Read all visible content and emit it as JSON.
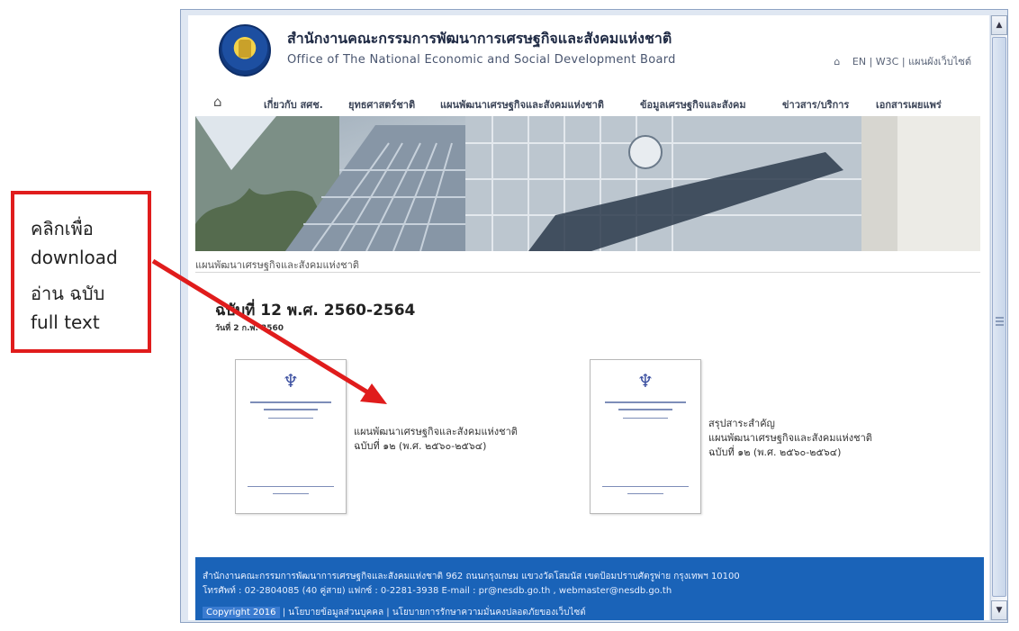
{
  "annotation": {
    "lines": [
      "คลิกเพื่อ",
      "download",
      "อ่าน ฉบับ",
      "full text"
    ],
    "color": "#e01c1c"
  },
  "header": {
    "org_name_th": "สำนักงานคณะกรรมการพัฒนาการเศรษฐกิจและสังคมแห่งชาติ",
    "org_name_en": "Office of The National Economic and Social Development Board",
    "top_links": [
      "EN",
      "W3C",
      "แผนผังเว็บไซต์"
    ]
  },
  "nav": {
    "items": [
      "เกี่ยวกับ สศช.",
      "ยุทธศาสตร์ชาติ",
      "แผนพัฒนาเศรษฐกิจและสังคมแห่งชาติ",
      "ข้อมูลเศรษฐกิจและสังคม",
      "ข่าวสาร/บริการ",
      "เอกสารเผยแพร่"
    ]
  },
  "banner": {
    "sign_text": "สำนักงานคณะกรรมการพัฒนาการเศรษฐกิจและสังคมแห่งชาติ"
  },
  "content": {
    "breadcrumb": "แผนพัฒนาเศรษฐกิจและสังคมแห่งชาติ",
    "heading": "ฉบับที่ 12 พ.ศ. 2560-2564",
    "date": "วันที่ 2 ก.พ. 2560",
    "documents": [
      {
        "lines": [
          "แผนพัฒนาเศรษฐกิจและสังคมแห่งชาติ",
          "ฉบับที่ ๑๒ (พ.ศ. ๒๕๖๐-๒๕๖๔)"
        ]
      },
      {
        "lines": [
          "สรุปสาระสำคัญ",
          "แผนพัฒนาเศรษฐกิจและสังคมแห่งชาติ",
          "ฉบับที่ ๑๒ (พ.ศ. ๒๕๖๐-๒๕๖๔)"
        ]
      }
    ]
  },
  "footer": {
    "address": "สำนักงานคณะกรรมการพัฒนาการเศรษฐกิจและสังคมแห่งชาติ 962 ถนนกรุงเกษม แขวงวัดโสมนัส เขตป้อมปราบศัตรูพ่าย กรุงเทพฯ 10100",
    "contact": "โทรศัพท์ : 02-2804085 (40 คู่สาย) แฟกซ์ : 0-2281-3938 E-mail : pr@nesdb.go.th , webmaster@nesdb.go.th",
    "highlight": "Copyright 2016",
    "policy_links": "| นโยบายข้อมูลส่วนบุคคล | นโยบายการรักษาความมั่นคงปลอดภัยของเว็บไซต์"
  },
  "colors": {
    "footer_bg": "#1a63b8",
    "callout_red": "#e01c1c"
  },
  "icons": {
    "home": "home-icon",
    "scroll_up": "chevron-up-icon",
    "scroll_down": "chevron-down-icon"
  }
}
